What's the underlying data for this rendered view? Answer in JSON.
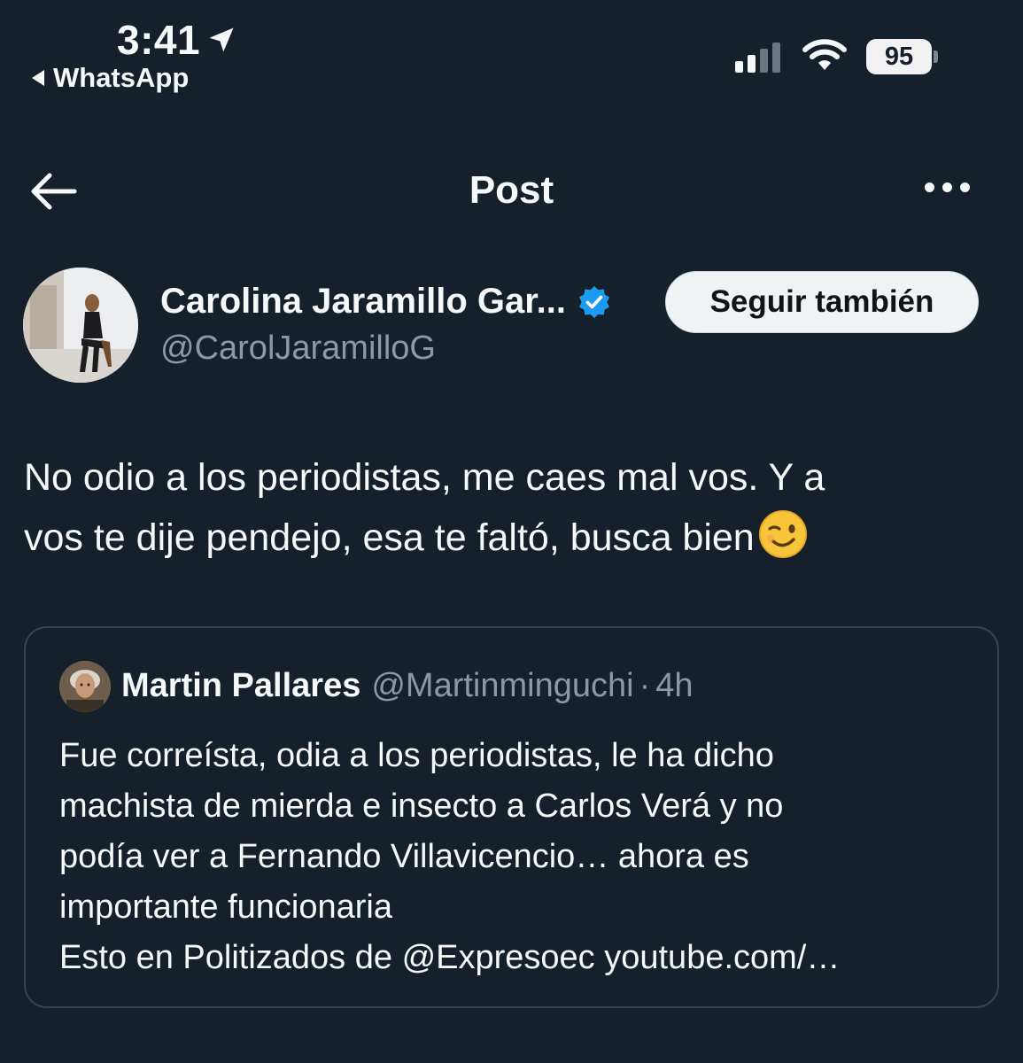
{
  "status_bar": {
    "time": "3:41",
    "back_app": "WhatsApp",
    "battery": "95"
  },
  "header": {
    "title": "Post",
    "back_icon": "arrow-left-icon",
    "more_icon": "more-horizontal-icon"
  },
  "author": {
    "name": "Carolina Jaramillo Gar...",
    "handle": "@CarolJaramilloG",
    "verified": true,
    "follow_label": "Seguir también"
  },
  "post": {
    "lines": [
      "No odio a los periodistas, me caes mal vos. Y a",
      "vos te dije pendejo, esa te faltó, busca bien"
    ],
    "emoji": "winking-face"
  },
  "quote": {
    "name": "Martin Pallares",
    "handle": "@Martinminguchi",
    "separator": "·",
    "time": "4h",
    "lines": [
      "Fue correísta, odia a los periodistas, le ha dicho",
      "machista de mierda e insecto a Carlos Verá y no",
      "podía ver a  Fernando Villavicencio… ahora es",
      "importante funcionaria",
      "Esto en Politizados de @Expresoec  youtube.com/…"
    ]
  },
  "colors": {
    "background": "#15202b",
    "text": "#f7f9f9",
    "secondary_text": "#8b98a5",
    "verified_blue": "#1d9bf0",
    "border": "#38444d"
  }
}
